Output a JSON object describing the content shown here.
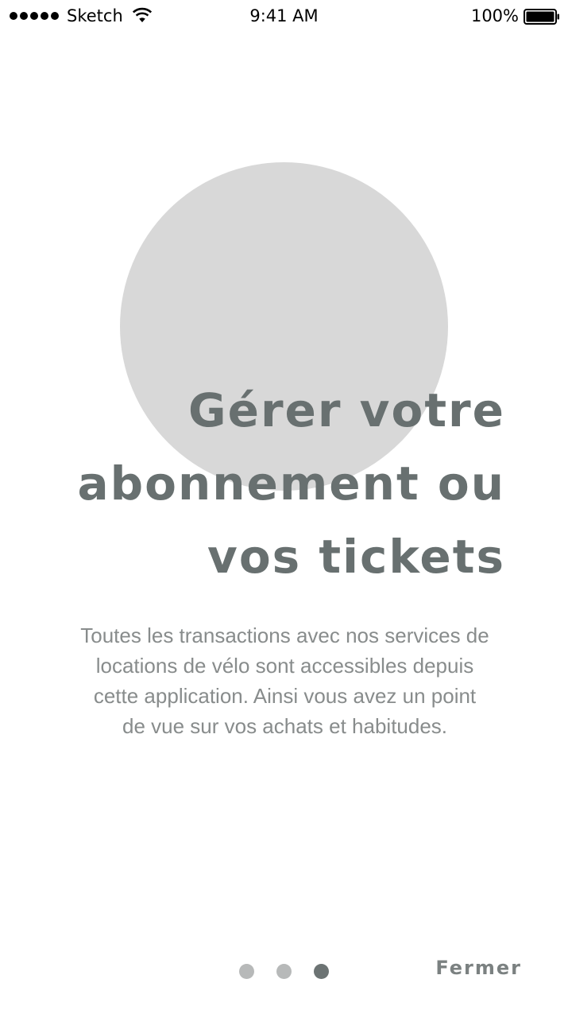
{
  "status_bar": {
    "carrier": "Sketch",
    "time": "9:41 AM",
    "battery": "100%",
    "signal_icon": "signal-dots-icon",
    "wifi_icon": "wifi-icon",
    "battery_icon": "battery-full-icon"
  },
  "onboarding": {
    "title_lines": [
      "Gérer votre",
      "abonnement ou",
      "vos tickets"
    ],
    "description_lines": [
      "Toutes les transactions avec nos services de",
      "locations de vélo sont accessibles depuis",
      "cette application. Ainsi vous avez un point",
      "de vue sur vos achats et habitudes."
    ],
    "page_indicator": {
      "total_pages": 3,
      "current_page": 3
    },
    "close_label": "Fermer"
  },
  "colors": {
    "title": "#687070",
    "description": "#888c8c",
    "circle": "#d8d8d8",
    "dot_inactive": "#b7b9b9",
    "dot_active": "#6c7373"
  }
}
